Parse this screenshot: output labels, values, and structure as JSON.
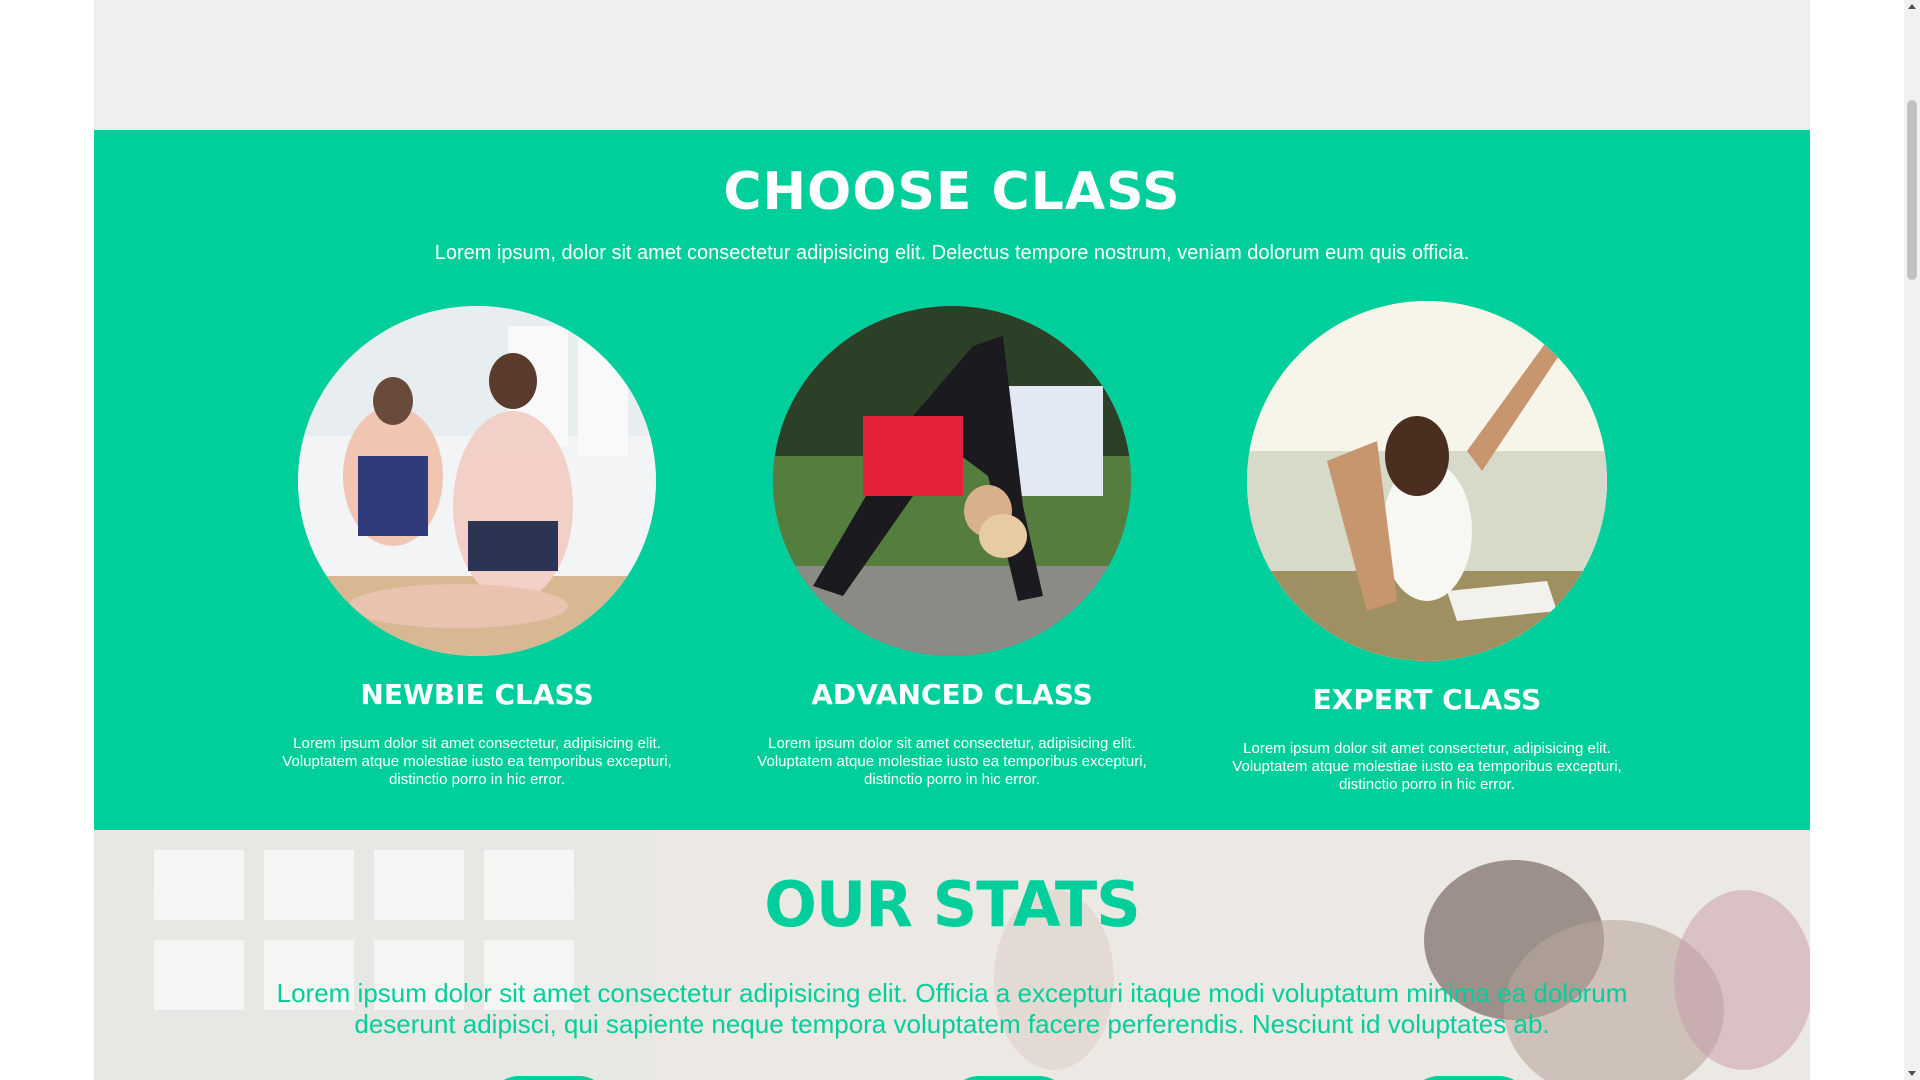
{
  "classes": {
    "title": "CHOOSE CLASS",
    "subtitle": "Lorem ipsum, dolor sit amet consectetur adipisicing elit. Delectus tempore nostrum, veniam dolorum eum quis officia.",
    "cards": [
      {
        "title": "NEWBIE CLASS",
        "description": "Lorem ipsum dolor sit amet consectetur, adipisicing elit. Voluptatem atque molestiae iusto ea temporibus excepturi, distinctio porro in hic error."
      },
      {
        "title": "ADVANCED CLASS",
        "description": "Lorem ipsum dolor sit amet consectetur, adipisicing elit. Voluptatem atque molestiae iusto ea temporibus excepturi, distinctio porro in hic error."
      },
      {
        "title": "EXPERT CLASS",
        "description": "Lorem ipsum dolor sit amet consectetur, adipisicing elit. Voluptatem atque molestiae iusto ea temporibus excepturi, distinctio porro in hic error."
      }
    ]
  },
  "stats": {
    "title": "OUR STATS",
    "description": "Lorem ipsum dolor sit amet consectetur adipisicing elit. Officia a excepturi itaque modi voluptatum minima ea dolorum deserunt adipisci, qui sapiente neque tempora voluptatem facere perferendis. Nesciunt id voluptates ab."
  },
  "colors": {
    "accent": "#00cf9c",
    "top_band": "#eeefee"
  }
}
